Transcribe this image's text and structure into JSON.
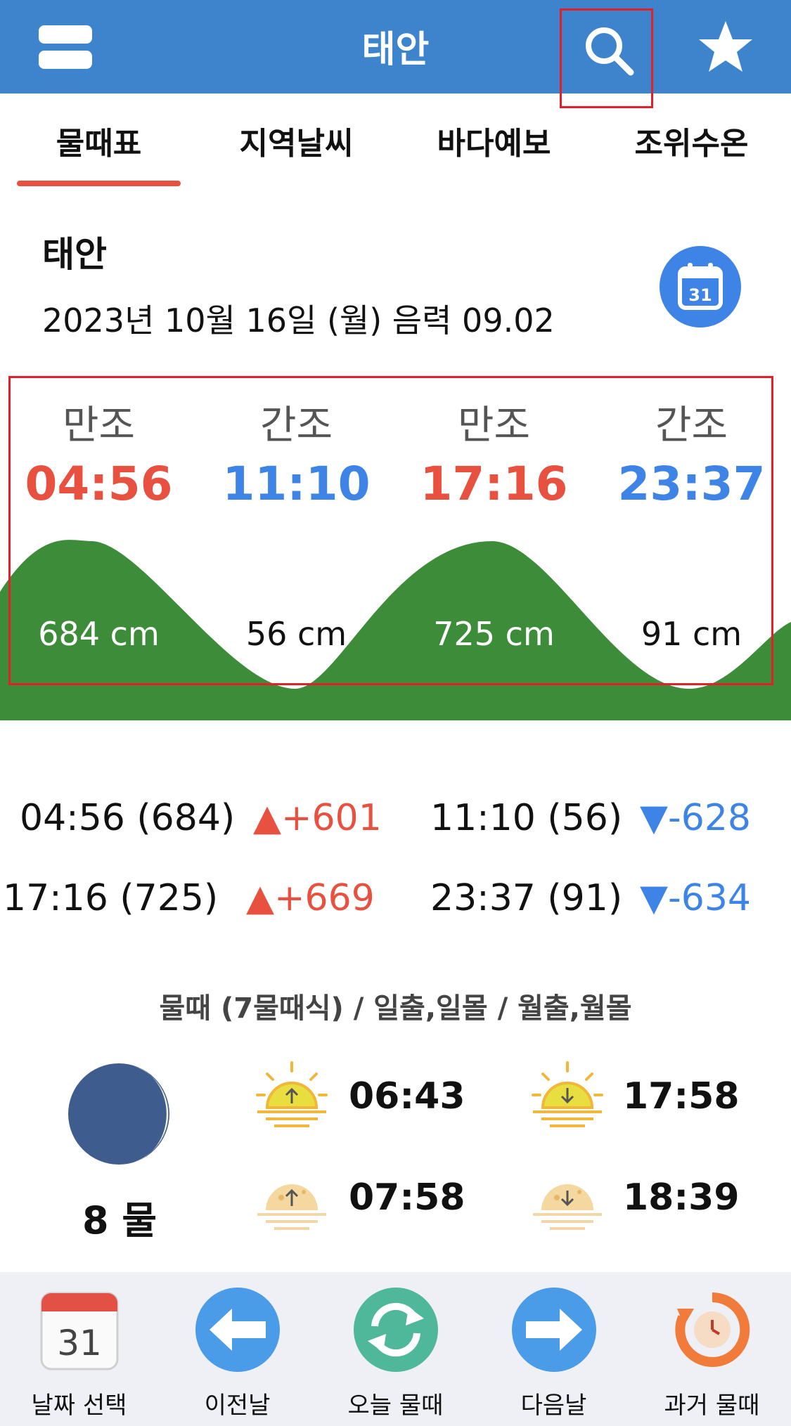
{
  "header": {
    "title": "태안"
  },
  "tabs": [
    {
      "label": "물때표"
    },
    {
      "label": "지역날씨"
    },
    {
      "label": "바다예보"
    },
    {
      "label": "조위수온"
    }
  ],
  "location": {
    "name": "태안",
    "date": "2023년 10월 16일 (월) 음력 09.02",
    "calendar_day": "31"
  },
  "tides": [
    {
      "type": "만조",
      "time": "04:56",
      "height": "684 cm"
    },
    {
      "type": "간조",
      "time": "11:10",
      "height": "56 cm"
    },
    {
      "type": "만조",
      "time": "17:16",
      "height": "725 cm"
    },
    {
      "type": "간조",
      "time": "23:37",
      "height": "91 cm"
    }
  ],
  "diffs": [
    {
      "entry": "04:56 (684)",
      "change": "▲+601"
    },
    {
      "entry": "11:10 (56)",
      "change": "▼-628"
    },
    {
      "entry": "17:16 (725)",
      "change": "▲+669"
    },
    {
      "entry": "23:37 (91)",
      "change": "▼-634"
    }
  ],
  "section_caption": "물때 (7물때식) / 일출,일몰 / 월출,월몰",
  "moon_phase": "8 물",
  "sun": {
    "sunrise": "06:43",
    "sunset": "17:58"
  },
  "moon": {
    "moonrise": "07:58",
    "moonset": "18:39"
  },
  "bottom_nav": [
    {
      "label": "날짜 선택",
      "icon": "calendar-icon",
      "day": "31"
    },
    {
      "label": "이전날",
      "icon": "arrow-left-icon"
    },
    {
      "label": "오늘 물때",
      "icon": "refresh-icon"
    },
    {
      "label": "다음날",
      "icon": "arrow-right-icon"
    },
    {
      "label": "과거 물때",
      "icon": "history-icon"
    }
  ],
  "colors": {
    "header": "#3d84cc",
    "high_tide": "#e8503f",
    "low_tide": "#3d84e6",
    "wave": "#3d8c3a",
    "tab_underline": "#e8503f",
    "highlight_frame": "#e3202a"
  }
}
